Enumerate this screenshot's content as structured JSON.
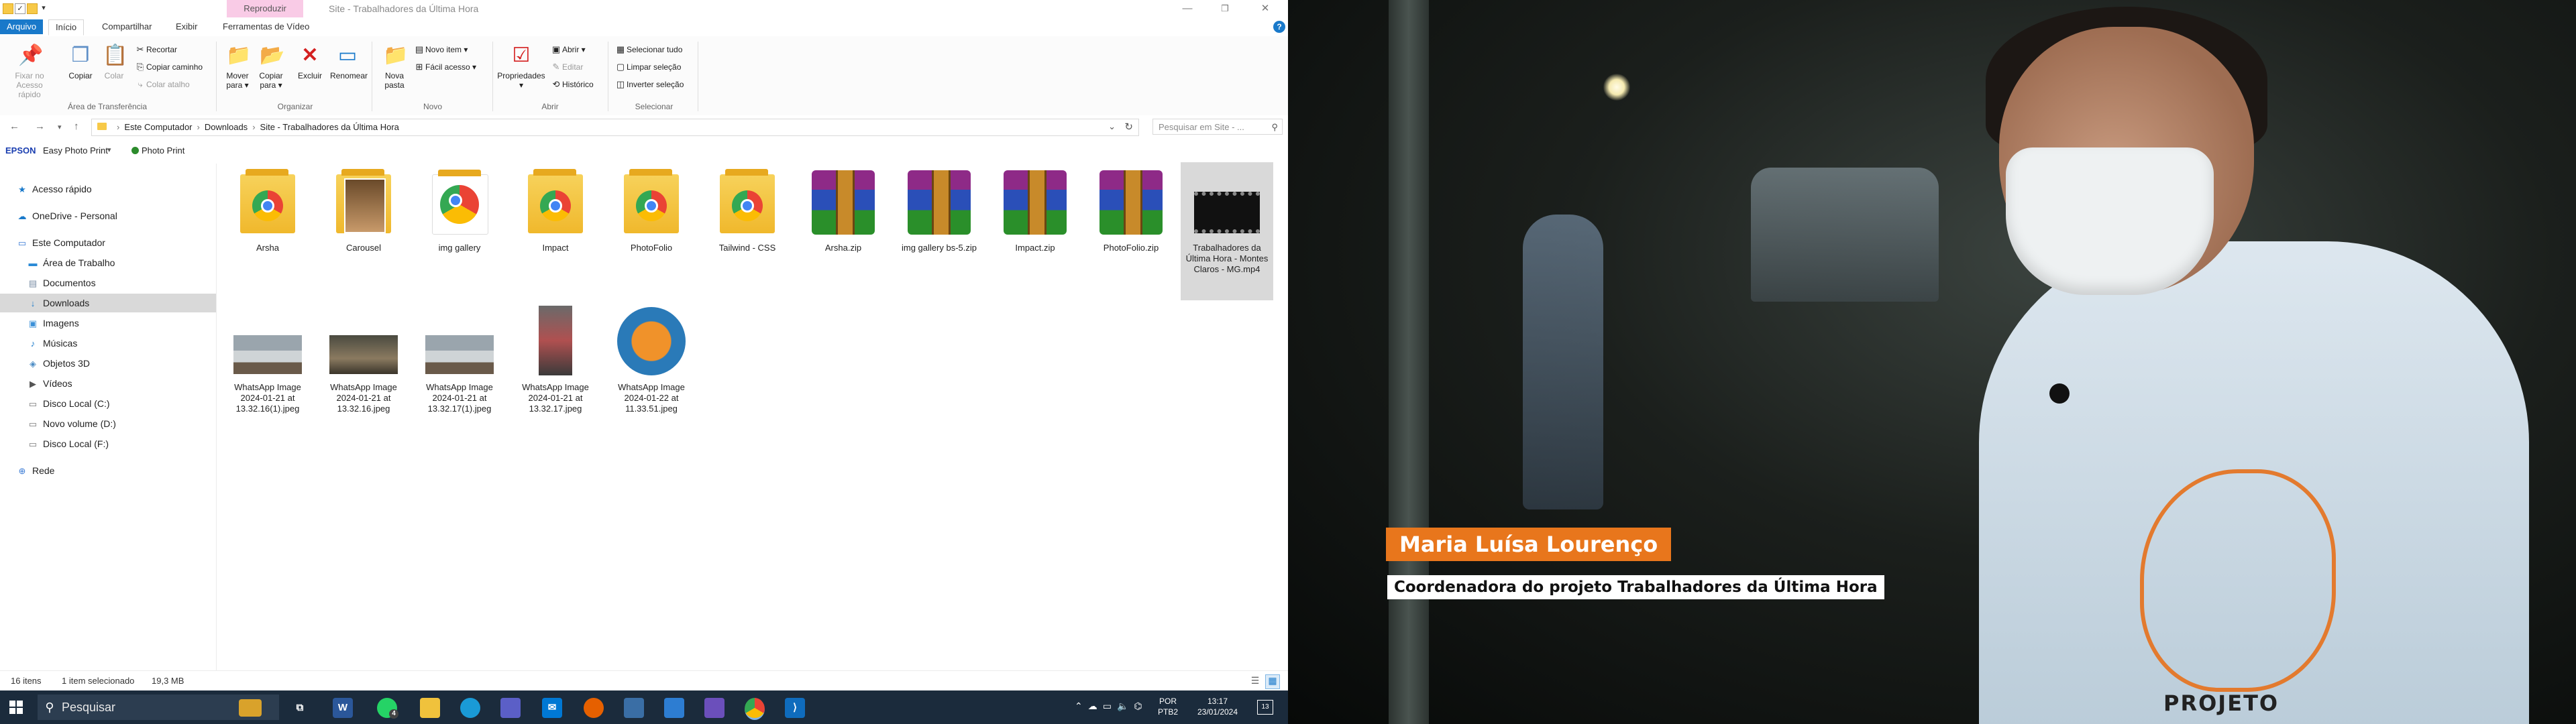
{
  "explorer": {
    "title": "Site - Trabalhadores da Última Hora",
    "context_tab": "Reproduzir",
    "tabs": [
      "Arquivo",
      "Início",
      "Compartilhar",
      "Exibir",
      "Ferramentas de Vídeo"
    ],
    "help_label": "?",
    "window_controls": {
      "minimize": "—",
      "maximize": "❐",
      "close": "✕"
    },
    "ribbon": {
      "clipboard": {
        "pin_label": "Fixar no Acesso rápido",
        "copy_label": "Copiar",
        "paste_label": "Colar",
        "cut_label": "Recortar",
        "copy_path_label": "Copiar caminho",
        "paste_shortcut_label": "Colar atalho",
        "group_label": "Área de Transferência"
      },
      "organize": {
        "move_label": "Mover para ▾",
        "copyto_label": "Copiar para ▾",
        "delete_label": "Excluir",
        "rename_label": "Renomear",
        "group_label": "Organizar"
      },
      "new": {
        "newfolder_label": "Nova pasta",
        "newitem_label": "Novo item ▾",
        "easyaccess_label": "Fácil acesso ▾",
        "group_label": "Novo"
      },
      "open": {
        "properties_label": "Propriedades ▾",
        "open_label": "Abrir ▾",
        "edit_label": "Editar",
        "history_label": "Histórico",
        "group_label": "Abrir"
      },
      "select": {
        "selectall_label": "Selecionar tudo",
        "clear_label": "Limpar seleção",
        "invert_label": "Inverter seleção",
        "group_label": "Selecionar"
      }
    },
    "breadcrumb": [
      "Este Computador",
      "Downloads",
      "Site - Trabalhadores da Última Hora"
    ],
    "search_placeholder": "Pesquisar em Site - ...",
    "epson": {
      "logo": "EPSON",
      "easy_label": "Easy Photo Print",
      "photoprint_label": "Photo Print"
    },
    "nav": [
      {
        "label": "Acesso rápido",
        "icon": "star-icon"
      },
      {
        "label": "OneDrive - Personal",
        "icon": "cloud-icon"
      },
      {
        "label": "Este Computador",
        "icon": "computer-icon"
      },
      {
        "label": "Área de Trabalho",
        "icon": "desktop-icon"
      },
      {
        "label": "Documentos",
        "icon": "document-icon"
      },
      {
        "label": "Downloads",
        "icon": "download-icon"
      },
      {
        "label": "Imagens",
        "icon": "image-icon"
      },
      {
        "label": "Músicas",
        "icon": "music-icon"
      },
      {
        "label": "Objetos 3D",
        "icon": "cube-icon"
      },
      {
        "label": "Vídeos",
        "icon": "video-icon"
      },
      {
        "label": "Disco Local (C:)",
        "icon": "drive-icon"
      },
      {
        "label": "Novo volume (D:)",
        "icon": "drive-icon"
      },
      {
        "label": "Disco Local (F:)",
        "icon": "drive-icon"
      },
      {
        "label": "Rede",
        "icon": "network-icon"
      }
    ],
    "files": [
      {
        "name": "Arsha",
        "kind": "chrome-folder"
      },
      {
        "name": "Carousel",
        "kind": "image-folder"
      },
      {
        "name": "img gallery",
        "kind": "chrome"
      },
      {
        "name": "Impact",
        "kind": "chrome-folder"
      },
      {
        "name": "PhotoFolio",
        "kind": "chrome-folder"
      },
      {
        "name": "Tailwind - CSS",
        "kind": "chrome-folder"
      },
      {
        "name": "Arsha.zip",
        "kind": "rar"
      },
      {
        "name": "img gallery bs-5.zip",
        "kind": "rar"
      },
      {
        "name": "Impact.zip",
        "kind": "rar"
      },
      {
        "name": "PhotoFolio.zip",
        "kind": "rar"
      },
      {
        "name": "Trabalhadores da Última Hora - Montes Claros - MG.mp4",
        "kind": "video"
      },
      {
        "name": "WhatsApp Image 2024-01-21 at 13.32.16(1).jpeg",
        "kind": "photo-van"
      },
      {
        "name": "WhatsApp Image 2024-01-21 at 13.32.16.jpeg",
        "kind": "photo-dark"
      },
      {
        "name": "WhatsApp Image 2024-01-21 at 13.32.17(1).jpeg",
        "kind": "photo-van"
      },
      {
        "name": "WhatsApp Image 2024-01-21 at 13.32.17.jpeg",
        "kind": "photo-portrait"
      },
      {
        "name": "WhatsApp Image 2024-01-22 at 11.33.51.jpeg",
        "kind": "photo-logo"
      }
    ],
    "status": {
      "count": "16 itens",
      "selected": "1 item selecionado",
      "size": "19,3 MB"
    }
  },
  "video": {
    "caption_name": "Maria Luísa Lourenço",
    "caption_role": "Coordenadora do projeto Trabalhadores da Última Hora",
    "shirt_text": "PROJETO"
  },
  "taskbar": {
    "search_label": "Pesquisar",
    "whatsapp_badge": "4",
    "lang_line1": "POR",
    "lang_line2": "PTB2",
    "time": "13:17",
    "date": "23/01/2024",
    "notif_count": "13"
  }
}
